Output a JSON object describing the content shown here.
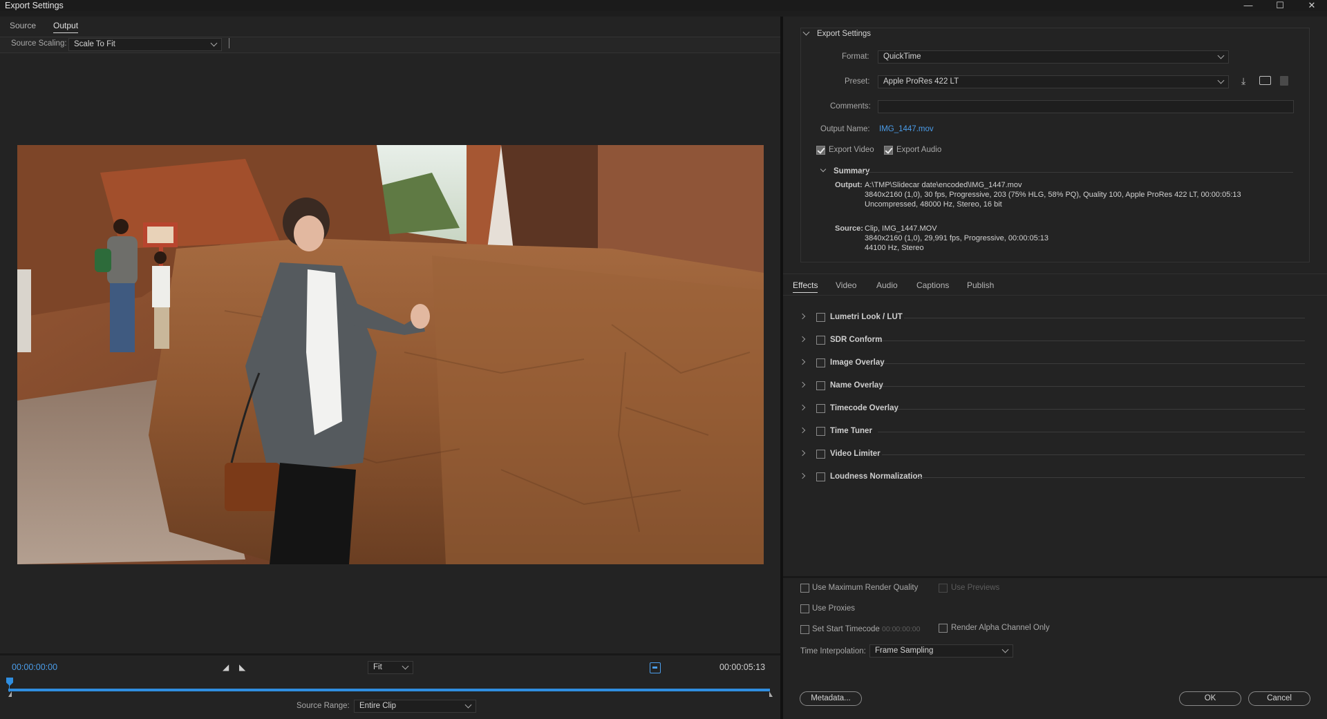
{
  "window": {
    "title": "Export Settings",
    "minimize": "—",
    "maximize": "☐",
    "close": "✕"
  },
  "left": {
    "tabs": [
      {
        "label": "Source"
      },
      {
        "label": "Output"
      }
    ],
    "source_scaling_label": "Source Scaling:",
    "source_scaling_value": "Scale To Fit",
    "timecode_start": "00:00:00:00",
    "zoom_value": "Fit",
    "timecode_end": "00:00:05:13",
    "source_range_label": "Source Range:",
    "source_range_value": "Entire Clip"
  },
  "export_settings": {
    "section_title": "Export Settings",
    "format_label": "Format:",
    "format_value": "QuickTime",
    "preset_label": "Preset:",
    "preset_value": "Apple ProRes 422 LT",
    "comments_label": "Comments:",
    "comments_value": "",
    "output_name_label": "Output Name:",
    "output_name_value": "IMG_1447.mov",
    "export_video_label": "Export Video",
    "export_video_checked": true,
    "export_audio_label": "Export Audio",
    "export_audio_checked": true
  },
  "summary": {
    "title": "Summary",
    "output_label": "Output:",
    "output_lines": [
      "A:\\TMP\\Slidecar date\\encoded\\IMG_1447.mov",
      "3840x2160 (1,0), 30 fps, Progressive, 203 (75% HLG, 58% PQ), Quality 100, Apple ProRes 422 LT, 00:00:05:13",
      "Uncompressed, 48000 Hz, Stereo, 16 bit"
    ],
    "source_label": "Source:",
    "source_lines": [
      "Clip, IMG_1447.MOV",
      "3840x2160 (1,0), 29,991 fps, Progressive, 00:00:05:13",
      "44100 Hz, Stereo"
    ]
  },
  "settings_tabs": [
    {
      "label": "Effects"
    },
    {
      "label": "Video"
    },
    {
      "label": "Audio"
    },
    {
      "label": "Captions"
    },
    {
      "label": "Publish"
    }
  ],
  "effects": [
    {
      "label": "Lumetri Look / LUT"
    },
    {
      "label": "SDR Conform"
    },
    {
      "label": "Image Overlay"
    },
    {
      "label": "Name Overlay"
    },
    {
      "label": "Timecode Overlay"
    },
    {
      "label": "Time Tuner"
    },
    {
      "label": "Video Limiter"
    },
    {
      "label": "Loudness Normalization"
    }
  ],
  "bottom": {
    "use_max_render_quality": "Use Maximum Render Quality",
    "use_previews": "Use Previews",
    "use_proxies": "Use Proxies",
    "set_start_timecode": "Set Start Timecode",
    "start_timecode_value": "00:00:00:00",
    "render_alpha_only": "Render Alpha Channel Only",
    "time_interpolation_label": "Time Interpolation:",
    "time_interpolation_value": "Frame Sampling",
    "metadata_button": "Metadata...",
    "ok_button": "OK",
    "cancel_button": "Cancel"
  },
  "colors": {
    "accent_blue": "#2f8ee0",
    "panel_bg": "#232323",
    "link_blue": "#4b9dea"
  },
  "icons": [
    "download-preset-icon",
    "import-preset-icon",
    "delete-preset-icon",
    "mark-in-icon",
    "mark-out-icon",
    "crop-toggle-icon"
  ]
}
